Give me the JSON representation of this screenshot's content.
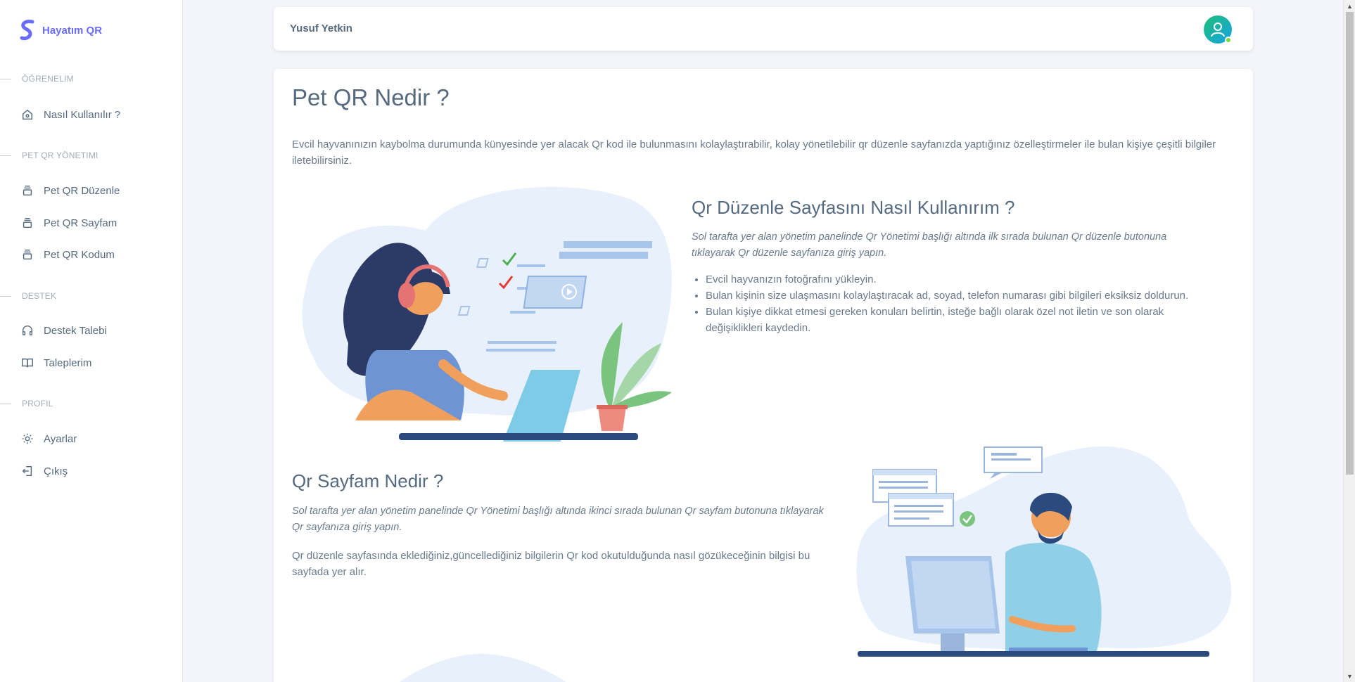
{
  "app": {
    "brand": "Hayatım QR"
  },
  "sidebar": {
    "sections": [
      {
        "header": "ÖĞRENELIM"
      },
      {
        "header": "PET QR YÖNETIMI"
      },
      {
        "header": "DESTEK"
      },
      {
        "header": "PROFIL"
      }
    ],
    "items": [
      {
        "label": "Nasıl Kullanılır ?",
        "icon": "home-icon"
      },
      {
        "label": "Pet QR Düzenle",
        "icon": "stack-icon"
      },
      {
        "label": "Pet QR Sayfam",
        "icon": "stack-icon"
      },
      {
        "label": "Pet QR Kodum",
        "icon": "stack-icon"
      },
      {
        "label": "Destek Talebi",
        "icon": "headphones-icon"
      },
      {
        "label": "Taleplerim",
        "icon": "book-icon"
      },
      {
        "label": "Ayarlar",
        "icon": "gear-icon"
      },
      {
        "label": "Çıkış",
        "icon": "logout-icon"
      }
    ]
  },
  "navbar": {
    "user_name": "Yusuf Yetkin"
  },
  "main": {
    "title": "Pet QR Nedir ?",
    "intro": "Evcil hayvanınızın kaybolma durumunda künyesinde yer alacak Qr kod ile bulunmasını kolaylaştırabilir, kolay yönetilebilir qr düzenle sayfanızda yaptığınız özelleştirmeler ile bulan kişiye çeşitli bilgiler iletebilirsiniz.",
    "section1": {
      "title": "Qr Düzenle Sayfasını Nasıl Kullanırım ?",
      "italic": "Sol tarafta yer alan yönetim panelinde Qr Yönetimi başlığı altında ilk sırada bulunan Qr düzenle butonuna tıklayarak Qr düzenle sayfanıza giriş yapın.",
      "steps": [
        "Evcil hayvanızın fotoğrafını yükleyin.",
        "Bulan kişinin size ulaşmasını kolaylaştıracak ad, soyad, telefon numarası gibi bilgileri eksiksiz doldurun.",
        "Bulan kişiye dikkat etmesi gereken konuları belirtin, isteğe bağlı olarak özel not iletin ve son olarak değişiklikleri kaydedin."
      ]
    },
    "section2": {
      "title": "Qr Sayfam Nedir ?",
      "italic": "Sol tarafta yer alan yönetim panelinde Qr Yönetimi başlığı altında ikinci sırada bulunan Qr sayfam butonuna tıklayarak Qr sayfanıza giriş yapın.",
      "text": "Qr düzenle sayfasında eklediğiniz,güncellediğiniz bilgilerin Qr kod okutulduğunda nasıl gözükeceğinin bilgisi bu sayfada yer alır."
    }
  },
  "colors": {
    "accent": "#696cff",
    "text": "#566a7f",
    "bg": "#f4f5fa"
  }
}
